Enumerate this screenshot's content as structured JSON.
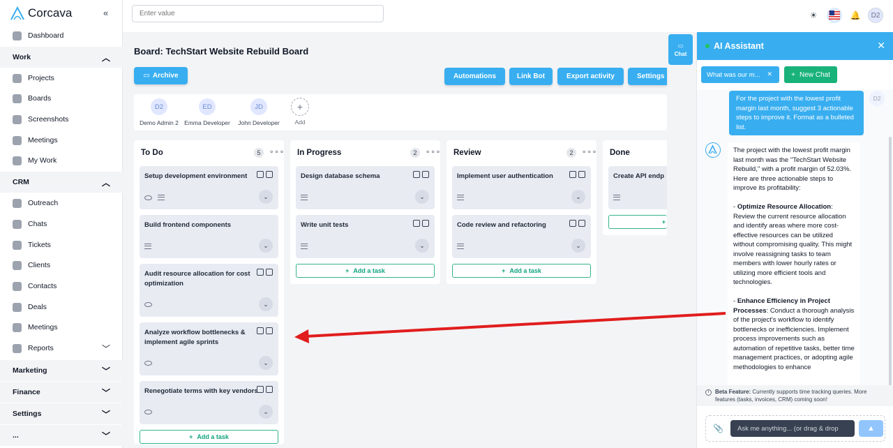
{
  "app": {
    "name": "Corcava",
    "collapse_icon": "«"
  },
  "search": {
    "placeholder": "Enter value"
  },
  "sidebar": {
    "dashboard": "Dashboard",
    "sections": {
      "work": "Work",
      "crm": "CRM",
      "reports": "Reports",
      "marketing": "Marketing",
      "finance": "Finance",
      "settings": "Settings",
      "more": "..."
    },
    "work_items": [
      "Projects",
      "Boards",
      "Screenshots",
      "Meetings",
      "My Work"
    ],
    "crm_items": [
      "Outreach",
      "Chats",
      "Tickets",
      "Clients",
      "Contacts",
      "Deals",
      "Meetings"
    ]
  },
  "topbar": {
    "user_initials": "D2"
  },
  "board": {
    "title": "Board: TechStart Website Rebuild Board",
    "archive": "Archive",
    "actions": [
      "Automations",
      "Link Bot",
      "Export activity",
      "Settings"
    ],
    "members": [
      {
        "initials": "D2",
        "name": "Demo Admin 2"
      },
      {
        "initials": "ED",
        "name": "Emma Developer"
      },
      {
        "initials": "JD",
        "name": "John Developer"
      }
    ],
    "add_member": "Add",
    "add_task": "Add a task",
    "columns": [
      {
        "name": "To Do",
        "count": "5",
        "cards": [
          "Setup development environment",
          "Build frontend components",
          "Audit resource allocation for cost optimization",
          "Analyze workflow bottlenecks & implement agile sprints",
          "Renegotiate terms with key vendors"
        ]
      },
      {
        "name": "In Progress",
        "count": "2",
        "cards": [
          "Design database schema",
          "Write unit tests"
        ]
      },
      {
        "name": "Review",
        "count": "2",
        "cards": [
          "Implement user authentication",
          "Code review and refactoring"
        ]
      },
      {
        "name": "Done",
        "count": "",
        "cards": [
          "Create API endp"
        ]
      }
    ]
  },
  "chat_tab": {
    "label": "Chat"
  },
  "assistant": {
    "title": "AI Assistant",
    "chip": "What was our m...",
    "new_chat": "New Chat",
    "user_initials": "D2",
    "user_message": "For the project with the lowest profit margin last month, suggest 3 actionable steps to improve it. Format as a bulleted list.",
    "bot_intro": "The project with the lowest profit margin last month was the \"TechStart Website Rebuild,\" with a profit margin of 52.03%. Here are three actionable steps to improve its profitability:",
    "step1_title": "Optimize Resource Allocation",
    "step1_body": ": Review the current resource allocation and identify areas where more cost-effective resources can be utilized without compromising quality. This might involve reassigning tasks to team members with lower hourly rates or utilizing more efficient tools and technologies.",
    "step2_title": "Enhance Efficiency in Project Processes",
    "step2_body": ": Conduct a thorough analysis of the project's workflow to identify bottlenecks or inefficiencies. Implement process improvements such as automation of repetitive tasks, better time management practices, or adopting agile methodologies to enhance",
    "beta_label": "Beta Feature:",
    "beta_text": " Currently supports time tracking queries. More features (tasks, invoices, CRM) coming soon!",
    "input_placeholder": "Ask me anything... (or drag & drop"
  },
  "colors": {
    "accent": "#38aef0",
    "green": "#18b27a",
    "arrow": "#e11d1d"
  }
}
